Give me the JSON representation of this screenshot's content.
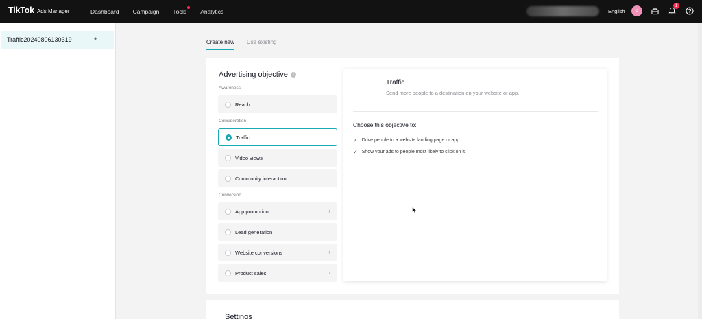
{
  "header": {
    "logo_main": "TikTok",
    "logo_sub": "Ads Manager",
    "nav": [
      "Dashboard",
      "Campaign",
      "Tools",
      "Analytics"
    ],
    "language": "English",
    "avatar_initial": "o",
    "notification_count": "1"
  },
  "sidebar": {
    "campaign_name": "Traffic20240806130319",
    "plus": "+",
    "more": "⋮"
  },
  "tabs": [
    "Create new",
    "Use existing"
  ],
  "objective": {
    "title": "Advertising objective",
    "groups": {
      "awareness": "Awareness",
      "consideration": "Consideration",
      "conversion": "Conversion"
    },
    "options": {
      "reach": "Reach",
      "traffic": "Traffic",
      "video_views": "Video views",
      "community_interaction": "Community interaction",
      "app_promotion": "App promotion",
      "lead_generation": "Lead generation",
      "website_conversions": "Website conversions",
      "product_sales": "Product sales"
    },
    "selected": "Traffic"
  },
  "description": {
    "title": "Traffic",
    "subtitle": "Send more people to a destination on your website or app.",
    "choose_heading": "Choose this objective to:",
    "reasons": [
      "Drive people to a website landing page or app.",
      "Show your ads to people most likely to click on it."
    ]
  },
  "settings": {
    "title": "Settings"
  },
  "colors": {
    "accent": "#1aa9b3",
    "topbar": "#121212",
    "notification": "#fe2c55"
  }
}
